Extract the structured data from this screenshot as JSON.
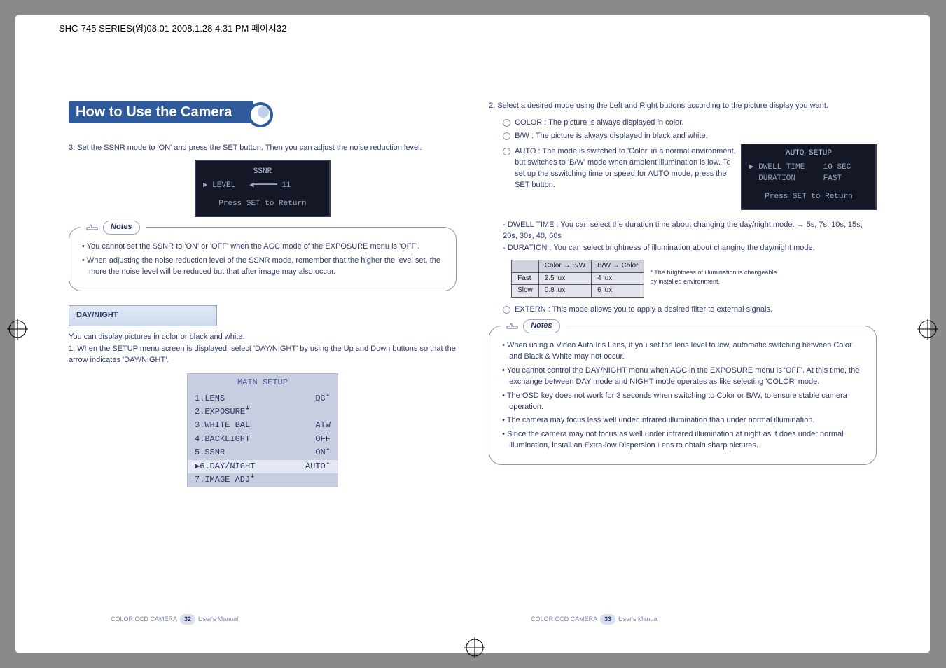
{
  "print_header": "SHC-745 SERIES(영)08.01  2008.1.28 4:31 PM  페이지32",
  "section_title": "How to Use the Camera",
  "left": {
    "step3": "3. Set the SSNR mode to 'ON' and press the SET button. Then you can adjust the noise reduction level.",
    "ssnr_osd": {
      "title": "SSNR",
      "row": "▶ LEVEL   ◀━━━━━ 11",
      "footer": "Press SET to Return"
    },
    "notes_label": "Notes",
    "notes": [
      "You cannot set the SSNR to 'ON' or 'OFF' when the AGC mode of the EXPOSURE menu is 'OFF'.",
      "When adjusting the noise reduction level of the SSNR mode, remember that the higher the level set, the more the noise level will be reduced  but that after image may also occur."
    ],
    "daynight_hdr": "DAY/NIGHT",
    "dn_line1": "You can display pictures in color or black and white.",
    "dn_step1": "1. When the SETUP menu screen is displayed, select 'DAY/NIGHT' by using the Up and Down buttons so that the arrow indicates 'DAY/NIGHT'.",
    "menu": {
      "title": "MAIN SETUP",
      "rows": [
        {
          "label": "1.LENS",
          "val": "DCꜜ"
        },
        {
          "label": "2.EXPOSUREꜜ",
          "val": ""
        },
        {
          "label": "3.WHITE BAL",
          "val": "ATW"
        },
        {
          "label": "4.BACKLIGHT",
          "val": "OFF"
        },
        {
          "label": "5.SSNR",
          "val": "ONꜜ"
        },
        {
          "label": "▶6.DAY/NIGHT",
          "val": "AUTOꜜ",
          "sel": true
        },
        {
          "label": "7.IMAGE ADJꜜ",
          "val": ""
        }
      ]
    },
    "footer": {
      "brand": "COLOR CCD CAMERA",
      "page": "32",
      "suffix": "User's Manual"
    }
  },
  "right": {
    "step2": "2. Select a desired mode using the Left and Right buttons according to the picture display you want.",
    "opts": [
      "COLOR : The picture is always displayed in color.",
      "B/W : The picture is always displayed in black and white.",
      "AUTO : The mode is switched to 'Color' in a normal environment, but switches to 'B/W' mode when ambient illumination is low. To set up the sswitching time or speed for AUTO mode, press the SET button."
    ],
    "auto_osd": {
      "title": "AUTO SETUP",
      "r1": "▶ DWELL TIME    10 SEC",
      "r2": "  DURATION      FAST",
      "footer": "Press SET to Return"
    },
    "dwell": "- DWELL TIME : You can select the duration time about changing the day/night mode. → 5s, 7s, 10s, 15s, 20s, 30s, 40, 60s",
    "duration": "- DURATION : You can select brightness of illumination about changing the day/night mode.",
    "table": {
      "hdr": [
        "",
        "Color → B/W",
        "B/W → Color"
      ],
      "rows": [
        [
          "Fast",
          "2.5 lux",
          "4 lux"
        ],
        [
          "Slow",
          "0.8 lux",
          "6 lux"
        ]
      ]
    },
    "table_foot1": "* The brightness of illumination is changeable",
    "table_foot2": "by installed environment.",
    "extern": "EXTERN : This mode allows you to apply a desired filter to external signals.",
    "notes_label": "Notes",
    "notes": [
      "When using a Video Auto Iris Lens, if you set the lens level to low, automatic switching between Color and Black & White may not occur.",
      "You cannot control the DAY/NIGHT menu when AGC in the EXPOSURE menu is 'OFF'. At this time, the exchange between DAY mode and NIGHT mode operates as like selecting 'COLOR' mode.",
      "The OSD key does not work for 3 seconds when switching to Color or B/W, to ensure stable camera operation.",
      "The camera may focus less well under infrared illumination than under normal illumination.",
      "Since the camera may not focus as well under infrared illumination at night as it does under normal illumination, install an Extra-low Dispersion Lens to obtain sharp pictures."
    ],
    "footer": {
      "brand": "COLOR CCD CAMERA",
      "page": "33",
      "suffix": "User's Manual"
    }
  }
}
